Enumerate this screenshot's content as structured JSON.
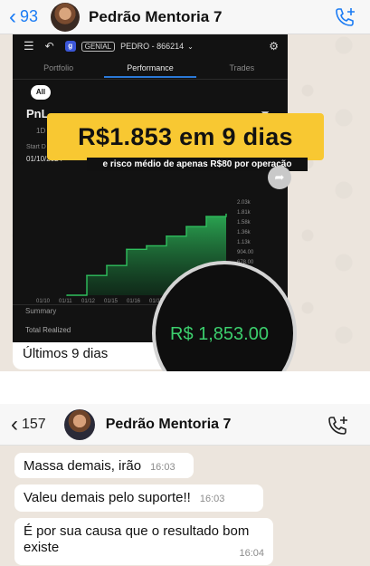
{
  "chat1": {
    "back_count": "93",
    "contact_name": "Pedrão Mentoria 7",
    "call_icon": "phone-plus-icon"
  },
  "app": {
    "broker_badge": "GENIAL",
    "account": "PEDRO - 866214",
    "tabs": [
      "Portfolio",
      "Performance",
      "Trades"
    ],
    "active_tab": "Performance",
    "filter_pill": "All",
    "title": "PnL",
    "period": "1D",
    "start_label": "Start D",
    "start_date": "01/10/2024",
    "summary_label": "Summary",
    "total_realized_label": "Total Realized",
    "accent_color": "#2a78d6",
    "line_color": "#2fbf5d"
  },
  "chart_data": {
    "type": "area",
    "x": [
      "01/10",
      "01/11",
      "01/12",
      "01/15",
      "01/16",
      "01/17",
      "01/18",
      "01/19",
      "01/22"
    ],
    "x_tick_labels": [
      "01/10",
      "01/11",
      "01/12",
      "01/15",
      "01/16",
      "01/17"
    ],
    "y_tick_labels": [
      "2.03k",
      "1.81k",
      "1.58k",
      "1.36k",
      "1.13k",
      "904.00",
      "678.00",
      "452.00"
    ],
    "values": [
      0,
      452,
      680,
      1050,
      1130,
      1350,
      1570,
      1800,
      1853
    ],
    "ylim": [
      0,
      2030
    ]
  },
  "overlay": {
    "headline": "R$1.853 em 9 dias",
    "subline": "e risco médio de apenas R$80 por operação",
    "magnified_amount": "R$ 1,853.00",
    "highlight_color": "#f8c832",
    "amount_color": "#3ccf6d"
  },
  "bubble_caption": "Últimos 9 dias",
  "chat2": {
    "back_count": "157",
    "contact_name": "Pedrão Mentoria 7",
    "call_icon": "phone-plus-icon",
    "messages": [
      {
        "text": "Massa demais, irão",
        "time": "16:03"
      },
      {
        "text": "Valeu demais pelo suporte!!",
        "time": "16:03"
      },
      {
        "text": "É por sua causa que o resultado bom existe",
        "time": "16:04"
      }
    ]
  }
}
